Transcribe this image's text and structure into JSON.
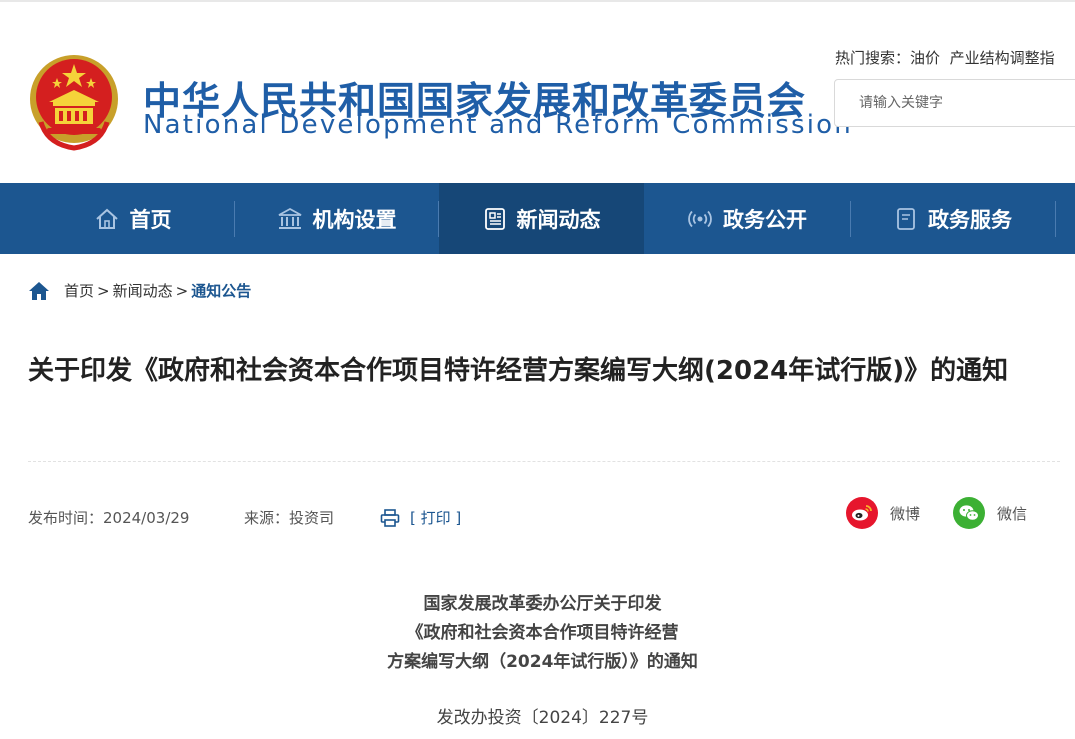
{
  "header": {
    "cn_name": "中华人民共和国国家发展和改革委员会",
    "en_name": "National Development and Reform Commission",
    "hot_label": "热门搜索：",
    "hot_keywords": [
      "油价",
      "产业结构调整指"
    ],
    "search_placeholder": "请输入关键字"
  },
  "nav": {
    "items": [
      {
        "label": "首页",
        "icon": "home-icon"
      },
      {
        "label": "机构设置",
        "icon": "building-icon"
      },
      {
        "label": "新闻动态",
        "icon": "news-icon",
        "active": true
      },
      {
        "label": "政务公开",
        "icon": "broadcast-icon"
      },
      {
        "label": "政务服务",
        "icon": "document-icon"
      }
    ]
  },
  "breadcrumb": {
    "items": [
      "首页",
      "新闻动态",
      "通知公告"
    ],
    "separator": ">"
  },
  "article": {
    "title": "关于印发《政府和社会资本合作项目特许经营方案编写大纲(2024年试行版)》的通知",
    "publish_time": "发布时间：2024/03/29",
    "source": "来源：投资司",
    "print_label": "[ 打印 ]",
    "share": {
      "weibo": "微博",
      "wechat": "微信"
    },
    "body_heading": [
      "国家发展改革委办公厅关于印发",
      "《政府和社会资本合作项目特许经营",
      "方案编写大纲（2024年试行版）》的通知"
    ],
    "doc_number": "发改办投资〔2024〕227号"
  },
  "colors": {
    "brand": "#1f5ea7",
    "nav_bg": "#1c5690",
    "nav_active": "#164777",
    "weibo": "#e6162d",
    "wechat": "#3cb034"
  }
}
